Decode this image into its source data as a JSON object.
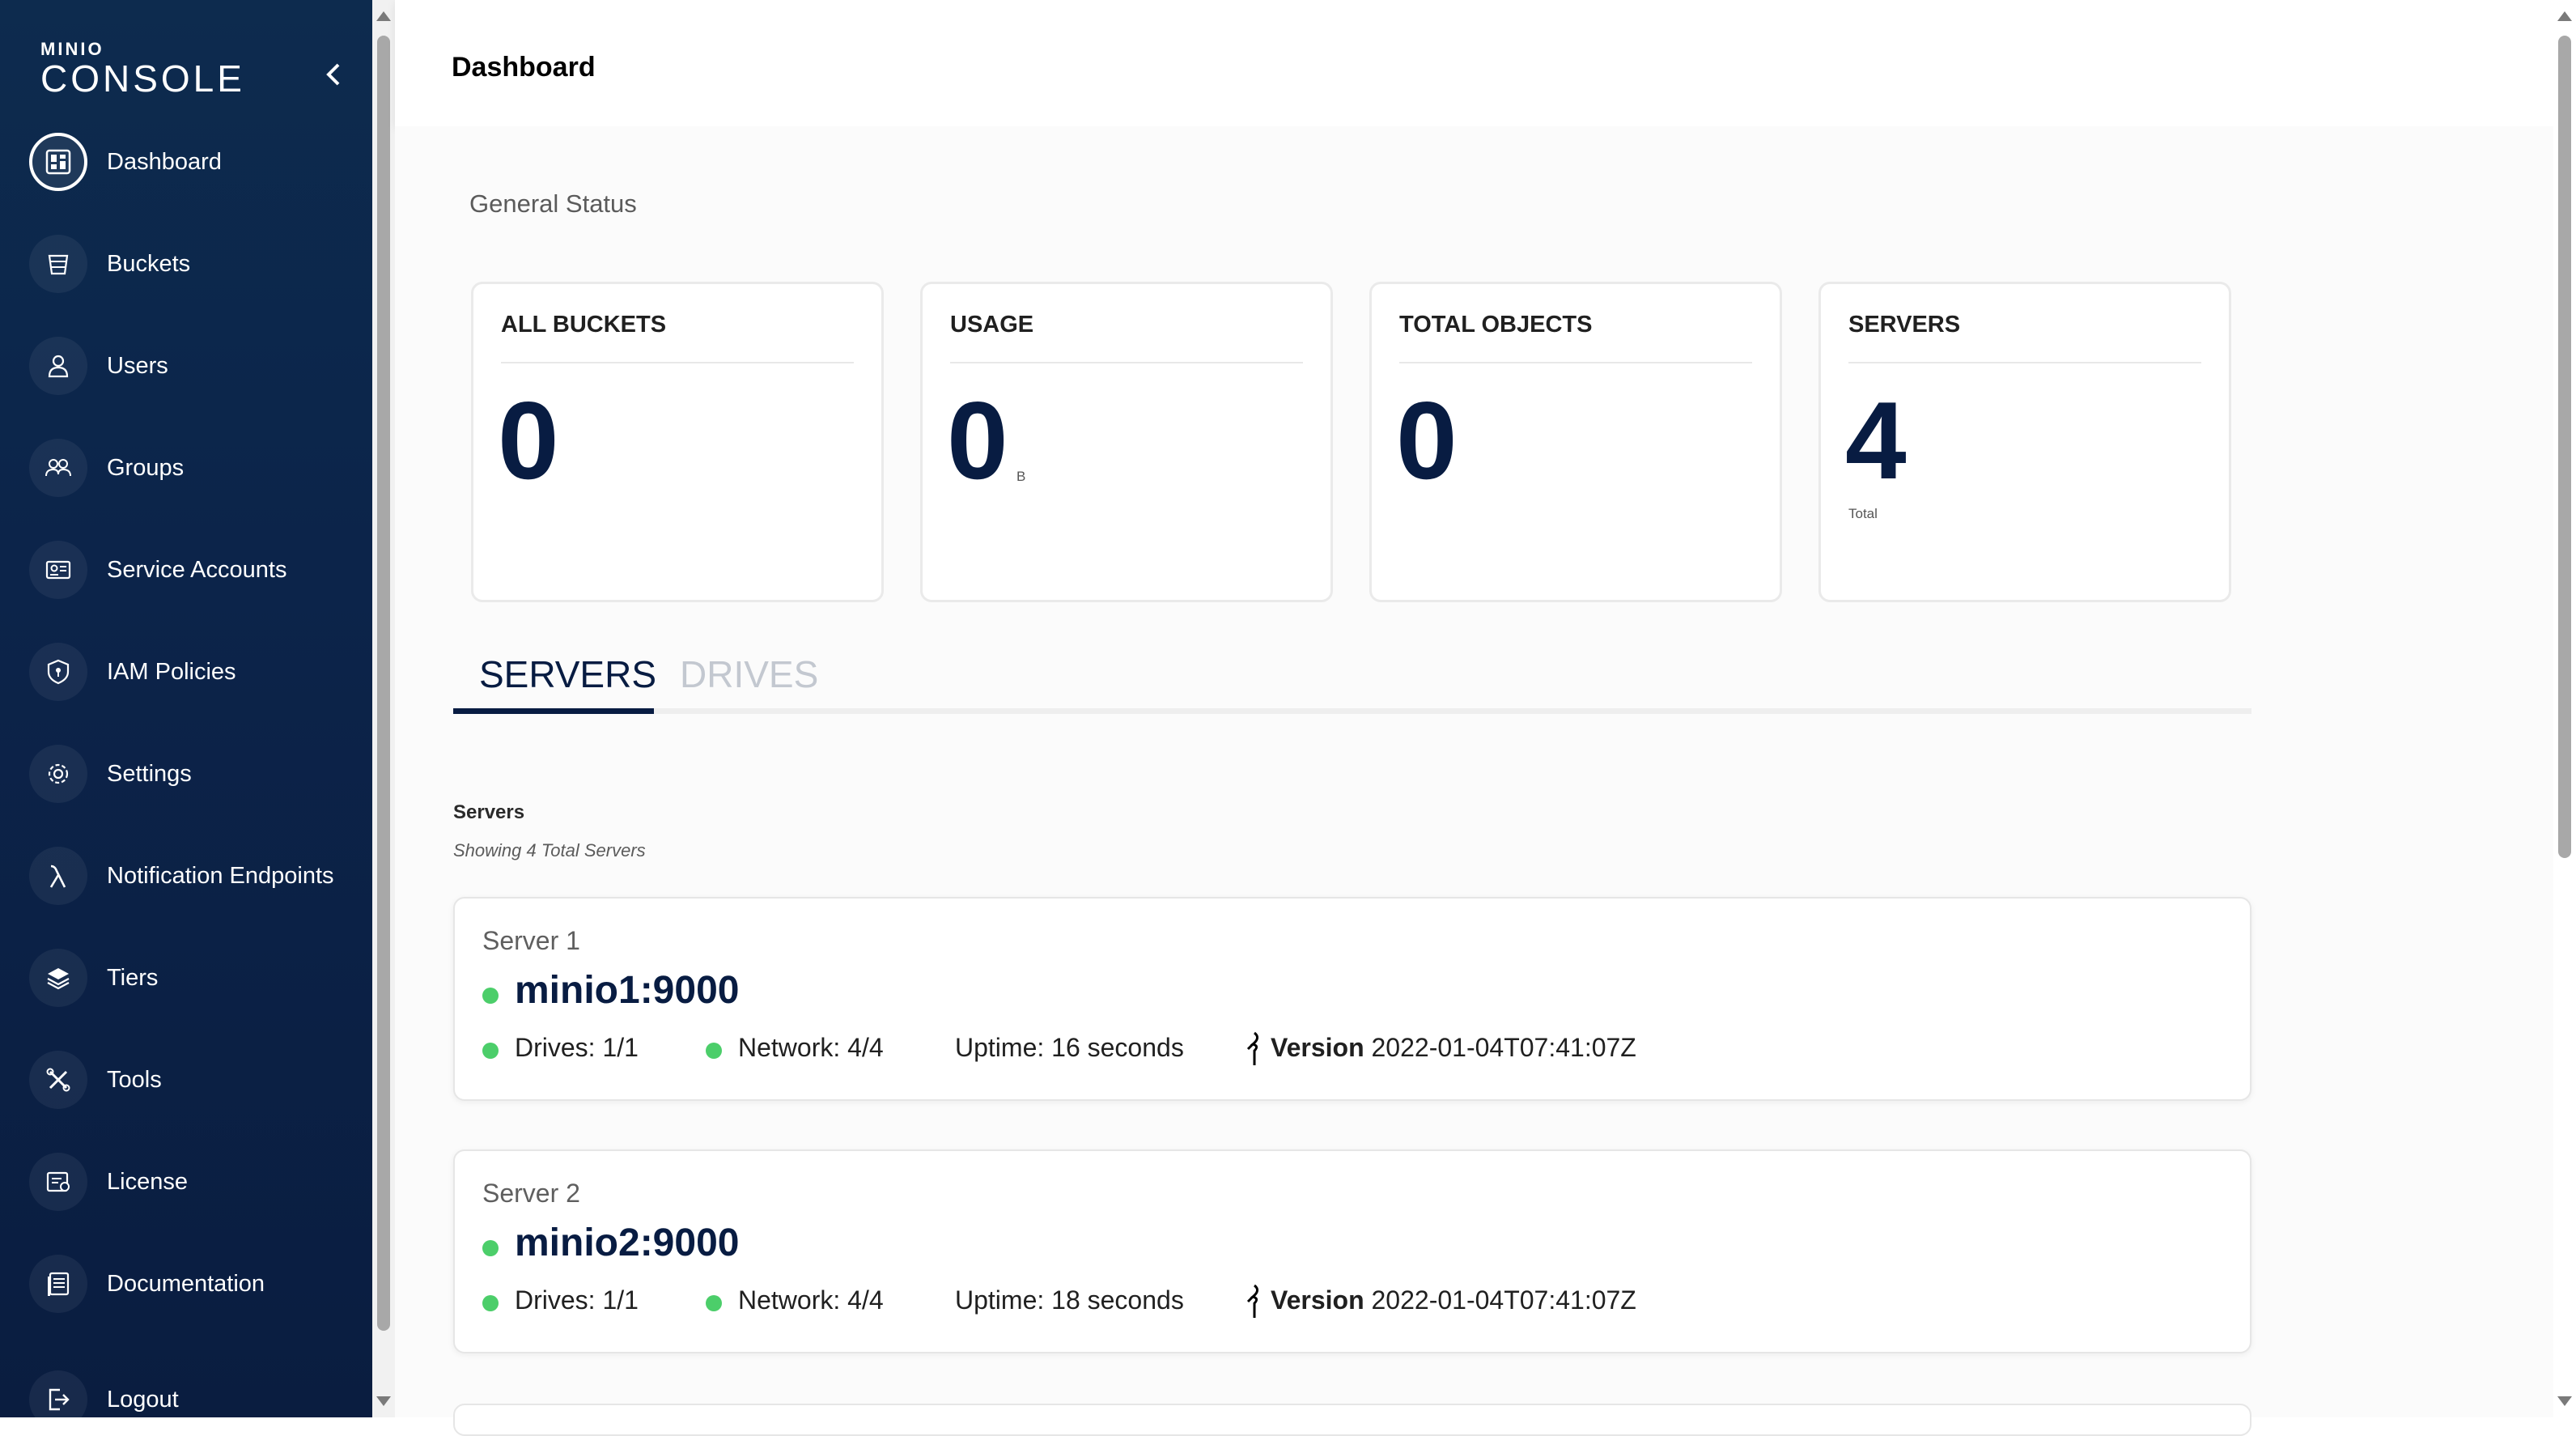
{
  "app": {
    "brand": "MINIO",
    "product": "CONSOLE"
  },
  "sidebar": {
    "items": [
      {
        "label": "Dashboard",
        "icon": "dashboard-icon",
        "active": true
      },
      {
        "label": "Buckets",
        "icon": "bucket-icon"
      },
      {
        "label": "Users",
        "icon": "user-icon"
      },
      {
        "label": "Groups",
        "icon": "groups-icon"
      },
      {
        "label": "Service Accounts",
        "icon": "service-account-icon"
      },
      {
        "label": "IAM Policies",
        "icon": "shield-icon"
      },
      {
        "label": "Settings",
        "icon": "gear-icon"
      },
      {
        "label": "Notification Endpoints",
        "icon": "lambda-icon"
      },
      {
        "label": "Tiers",
        "icon": "layers-icon"
      },
      {
        "label": "Tools",
        "icon": "tools-icon"
      },
      {
        "label": "License",
        "icon": "license-icon"
      },
      {
        "label": "Documentation",
        "icon": "documentation-icon"
      },
      {
        "label": "Logout",
        "icon": "logout-icon"
      }
    ]
  },
  "header": {
    "title": "Dashboard"
  },
  "main": {
    "section_title": "General Status",
    "stats": [
      {
        "label": "ALL BUCKETS",
        "value": "0",
        "unit": ""
      },
      {
        "label": "USAGE",
        "value": "0",
        "unit": "B"
      },
      {
        "label": "TOTAL OBJECTS",
        "value": "0",
        "unit": ""
      },
      {
        "label": "SERVERS",
        "value": "4",
        "unit": "Total"
      }
    ],
    "tabs": [
      {
        "label": "SERVERS",
        "active": true
      },
      {
        "label": "DRIVES",
        "active": false
      }
    ],
    "servers_title": "Servers",
    "servers_subtitle": "Showing 4 Total Servers",
    "servers": [
      {
        "name": "Server 1",
        "endpoint": "minio1:9000",
        "drives": "Drives: 1/1",
        "network": "Network: 4/4",
        "uptime": "Uptime: 16 seconds",
        "version_label": "Version",
        "version": "2022-01-04T07:41:07Z"
      },
      {
        "name": "Server 2",
        "endpoint": "minio2:9000",
        "drives": "Drives: 1/1",
        "network": "Network: 4/4",
        "uptime": "Uptime: 18 seconds",
        "version_label": "Version",
        "version": "2022-01-04T07:41:07Z"
      }
    ]
  },
  "colors": {
    "sidebar_bg": "#0c244a",
    "primary": "#081c42",
    "status_online": "#4cce6a"
  }
}
